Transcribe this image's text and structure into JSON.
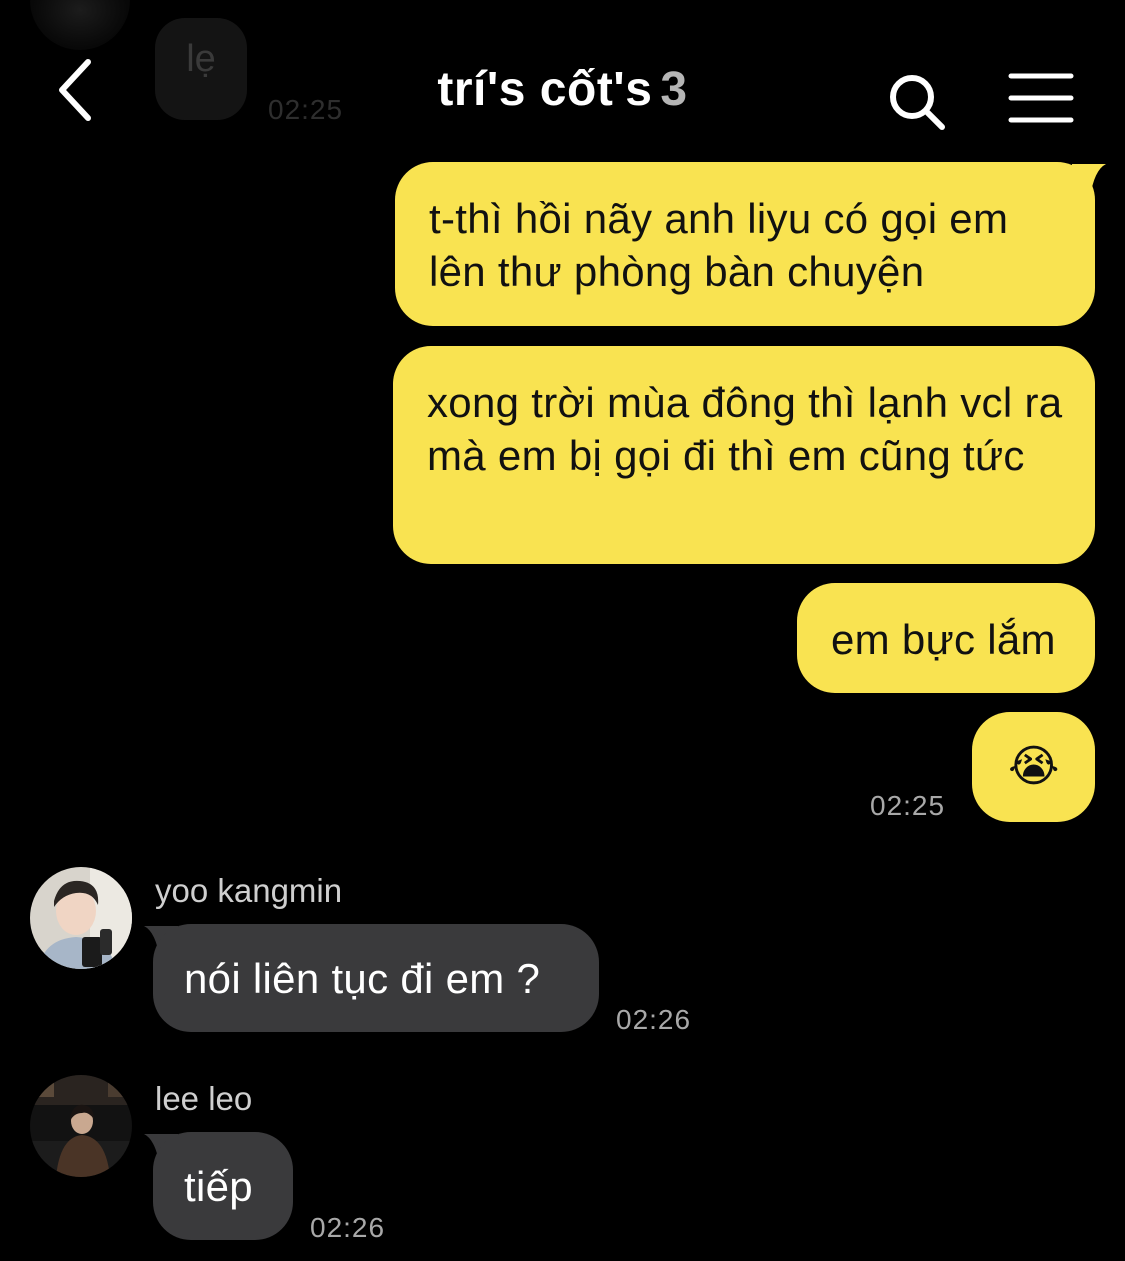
{
  "background_message": {
    "text": "lẹ",
    "time": "02:25"
  },
  "header": {
    "title": "trí's cốt's",
    "member_count": "3",
    "back_icon": "chevron-left-icon",
    "search_icon": "search-icon",
    "menu_icon": "hamburger-menu-icon"
  },
  "messages": {
    "mine": [
      {
        "text": "t-thì hồi nãy anh liyu có gọi em lên thư phòng bàn chuyện"
      },
      {
        "text": "xong trời mùa đông thì lạnh vcl ra mà em bị gọi đi thì em cũng tức"
      },
      {
        "text": "em bực lắm"
      },
      {
        "text": "😭"
      }
    ],
    "mine_time": "02:25",
    "kangmin": {
      "sender": "yoo kangmin",
      "text": "nói liên tục đi em ?",
      "time": "02:26"
    },
    "leo": {
      "sender": "lee leo",
      "text": "tiếp",
      "time": "02:26"
    }
  },
  "colors": {
    "background": "#000000",
    "my_bubble": "#f9e351",
    "their_bubble": "#3a3a3c",
    "timestamp": "#a8a8a8"
  }
}
